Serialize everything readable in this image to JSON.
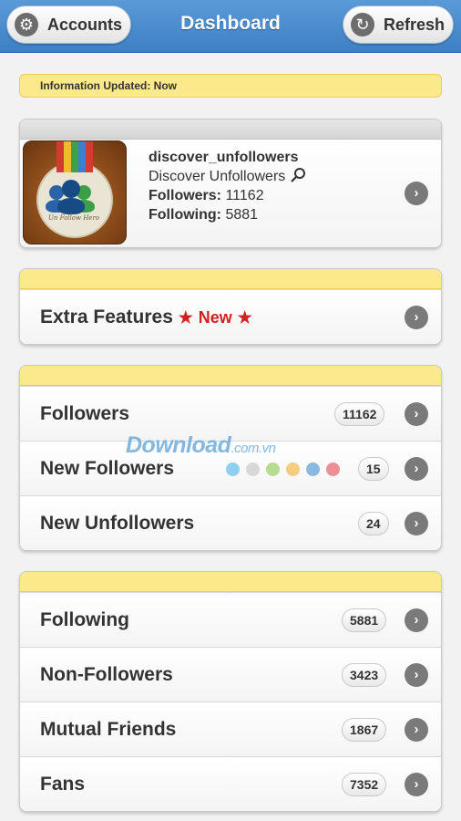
{
  "header": {
    "title": "Dashboard",
    "accounts_label": "Accounts",
    "refresh_label": "Refresh",
    "accounts_icon": "gear-icon",
    "refresh_icon": "refresh-icon"
  },
  "info": {
    "text": "Information Updated: Now"
  },
  "profile": {
    "username": "discover_unfollowers",
    "display_name": "Discover Unfollowers",
    "followers_label": "Followers:",
    "followers_value": "11162",
    "following_label": "Following:",
    "following_value": "5881",
    "avatar_caption": "Un Follow Hero"
  },
  "extra": {
    "label": "Extra Features",
    "star": "★",
    "new_label": "New"
  },
  "group1": [
    {
      "label": "Followers",
      "count": "11162"
    },
    {
      "label": "New Followers",
      "count": "15"
    },
    {
      "label": "New Unfollowers",
      "count": "24"
    }
  ],
  "group2": [
    {
      "label": "Following",
      "count": "5881"
    },
    {
      "label": "Non-Followers",
      "count": "3423"
    },
    {
      "label": "Mutual Friends",
      "count": "1867"
    },
    {
      "label": "Fans",
      "count": "7352"
    }
  ],
  "watermark": {
    "main": "Download",
    "suffix": ".com.vn"
  },
  "colors": {
    "accent_blue": "#3d80c4",
    "highlight_yellow": "#fbe98c",
    "new_red": "#d42020",
    "dots": [
      "#8fd0f0",
      "#d8d8d8",
      "#b6dc94",
      "#f6cb82",
      "#8ab8e0",
      "#ee8f98"
    ]
  }
}
